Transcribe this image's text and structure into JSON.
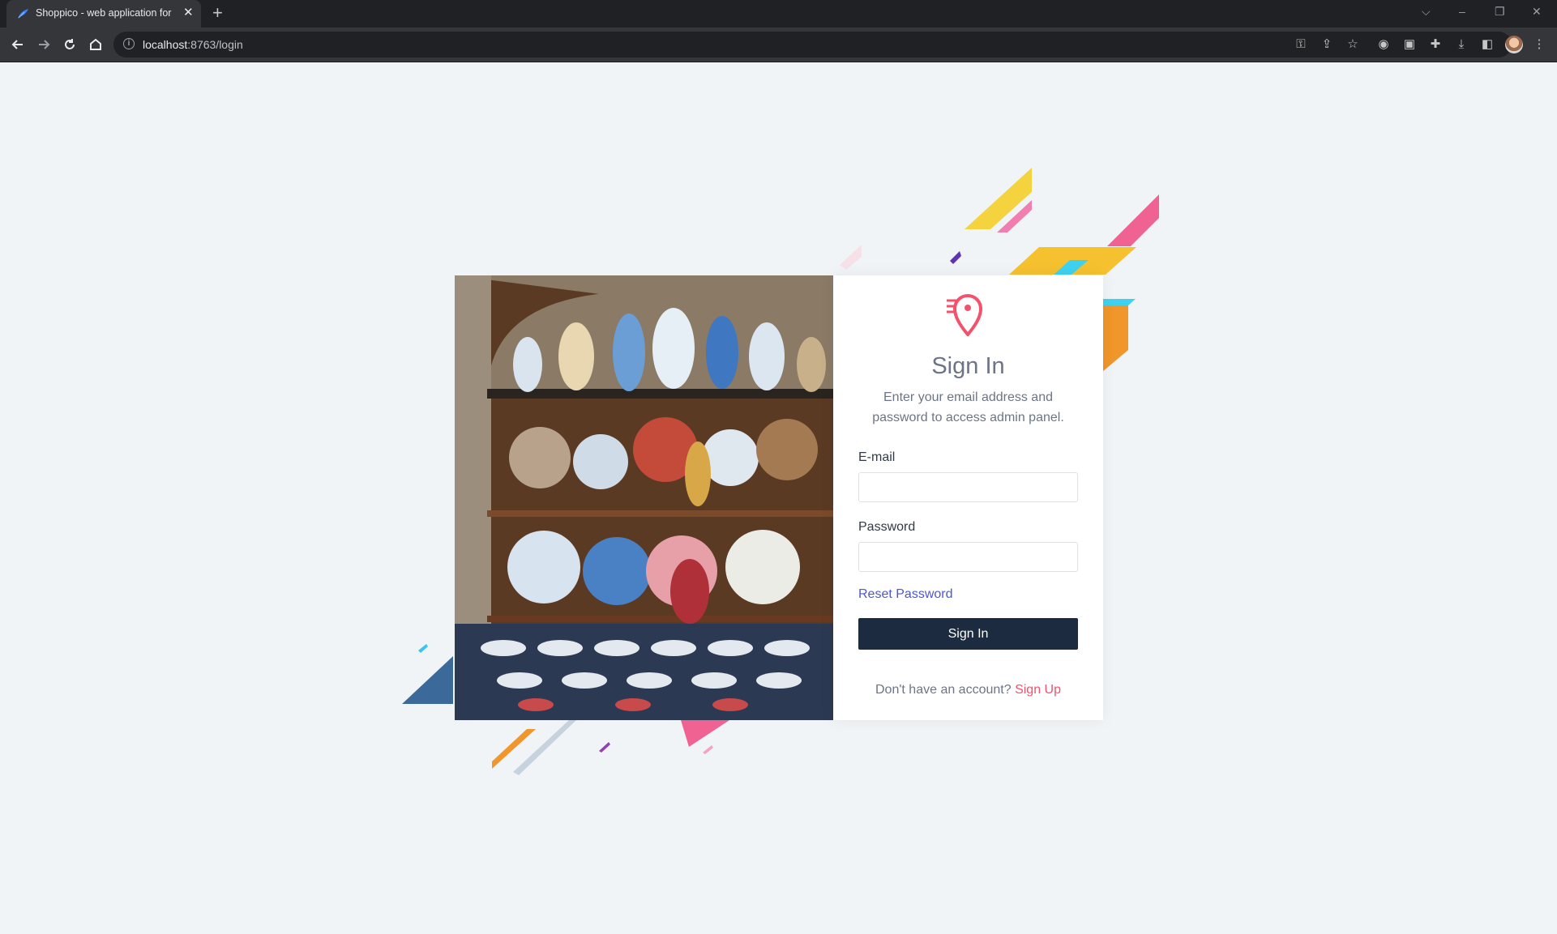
{
  "browser": {
    "tab_title": "Shoppico - web application for e",
    "tab_close": "✕",
    "new_tab": "+",
    "url_host": "localhost",
    "url_rest": ":8763/login",
    "window_controls": [
      "⌵",
      "–",
      "❐",
      "✕"
    ]
  },
  "login": {
    "title": "Sign In",
    "subtitle_line1": "Enter your email address and",
    "subtitle_line2": "password to access admin panel.",
    "email_label": "E-mail",
    "email_value": "",
    "password_label": "Password",
    "password_value": "",
    "reset_link": "Reset Password",
    "submit_label": "Sign In",
    "signup_prompt": "Don't have an account?",
    "signup_link": "Sign Up"
  },
  "colors": {
    "page_bg": "#f0f4f7",
    "accent": "#f4516c",
    "button": "#1c2b3f",
    "link": "#4d58c9"
  },
  "icons": {
    "brand": "map-pin-icon",
    "illustration": "pottery-shop-photo"
  }
}
